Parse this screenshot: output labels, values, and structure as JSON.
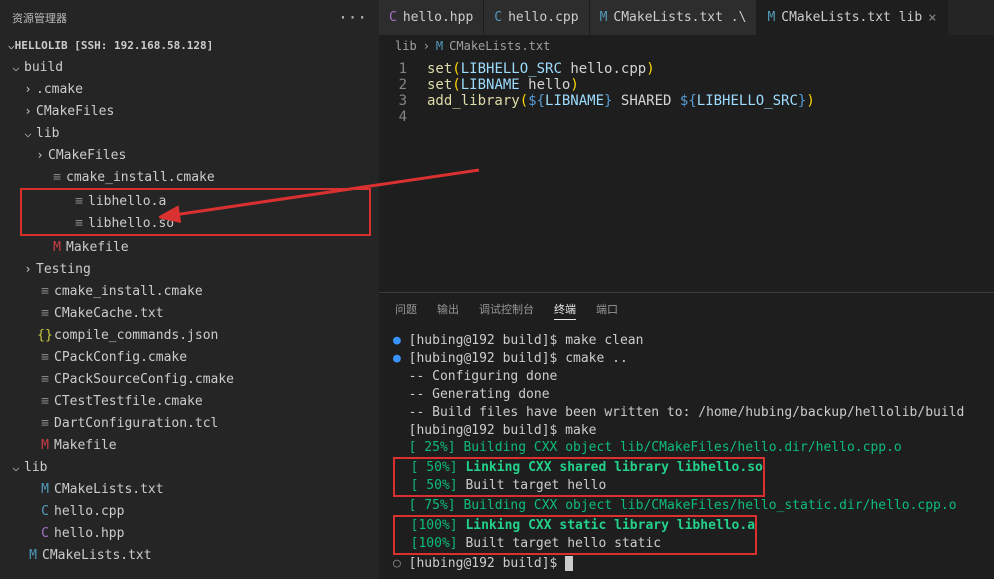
{
  "sidebar": {
    "title": "资源管理器",
    "project": "HELLOLIB [SSH: 192.168.58.128]",
    "tree": [
      {
        "label": "build",
        "type": "folder",
        "open": true,
        "indent": 0
      },
      {
        "label": ".cmake",
        "type": "folder",
        "open": false,
        "indent": 1
      },
      {
        "label": "CMakeFiles",
        "type": "folder",
        "open": false,
        "indent": 1
      },
      {
        "label": "lib",
        "type": "folder",
        "open": true,
        "indent": 1
      },
      {
        "label": "CMakeFiles",
        "type": "folder",
        "open": false,
        "indent": 2
      },
      {
        "label": "cmake_install.cmake",
        "type": "file",
        "icon": "≡",
        "iconClass": "ic-gray",
        "indent": 2
      },
      {
        "label": "libhello.a",
        "type": "file",
        "icon": "≡",
        "iconClass": "ic-gray",
        "indent": 2,
        "boxed": true
      },
      {
        "label": "libhello.so",
        "type": "file",
        "icon": "≡",
        "iconClass": "ic-gray",
        "indent": 2,
        "boxed": true
      },
      {
        "label": "Makefile",
        "type": "file",
        "icon": "M",
        "iconClass": "ic-red",
        "indent": 2
      },
      {
        "label": "Testing",
        "type": "folder",
        "open": false,
        "indent": 1
      },
      {
        "label": "cmake_install.cmake",
        "type": "file",
        "icon": "≡",
        "iconClass": "ic-gray",
        "indent": 1
      },
      {
        "label": "CMakeCache.txt",
        "type": "file",
        "icon": "≡",
        "iconClass": "ic-gray",
        "indent": 1
      },
      {
        "label": "compile_commands.json",
        "type": "file",
        "icon": "{}",
        "iconClass": "ic-yellow",
        "indent": 1
      },
      {
        "label": "CPackConfig.cmake",
        "type": "file",
        "icon": "≡",
        "iconClass": "ic-gray",
        "indent": 1
      },
      {
        "label": "CPackSourceConfig.cmake",
        "type": "file",
        "icon": "≡",
        "iconClass": "ic-gray",
        "indent": 1
      },
      {
        "label": "CTestTestfile.cmake",
        "type": "file",
        "icon": "≡",
        "iconClass": "ic-gray",
        "indent": 1
      },
      {
        "label": "DartConfiguration.tcl",
        "type": "file",
        "icon": "≡",
        "iconClass": "ic-gray",
        "indent": 1
      },
      {
        "label": "Makefile",
        "type": "file",
        "icon": "M",
        "iconClass": "ic-red",
        "indent": 1
      },
      {
        "label": "lib",
        "type": "folder",
        "open": true,
        "indent": 0
      },
      {
        "label": "CMakeLists.txt",
        "type": "file",
        "icon": "M",
        "iconClass": "ic-blue",
        "indent": 1
      },
      {
        "label": "hello.cpp",
        "type": "file",
        "icon": "C",
        "iconClass": "ic-blue",
        "indent": 1
      },
      {
        "label": "hello.hpp",
        "type": "file",
        "icon": "C",
        "iconClass": "ic-purple",
        "indent": 1
      },
      {
        "label": "CMakeLists.txt",
        "type": "file",
        "icon": "M",
        "iconClass": "ic-blue",
        "indent": 0
      }
    ]
  },
  "tabs": [
    {
      "label": "hello.hpp",
      "icon": "C",
      "iconClass": "ic-purple",
      "active": false
    },
    {
      "label": "hello.cpp",
      "icon": "C",
      "iconClass": "ic-blue",
      "active": false
    },
    {
      "label": "CMakeLists.txt .\\",
      "icon": "M",
      "iconClass": "ic-blue",
      "active": false
    },
    {
      "label": "CMakeLists.txt lib",
      "icon": "M",
      "iconClass": "ic-blue",
      "active": true
    }
  ],
  "breadcrumb": {
    "path": "lib",
    "sep": "›",
    "file": "CMakeLists.txt",
    "icon": "M"
  },
  "editor": {
    "lines": [
      {
        "n": 1,
        "segs": [
          [
            "c-fn",
            "set"
          ],
          [
            "c-br",
            "("
          ],
          [
            "c-var",
            "LIBHELLO_SRC"
          ],
          [
            "c-punc",
            " hello.cpp"
          ],
          [
            "c-br",
            ")"
          ]
        ]
      },
      {
        "n": 2,
        "segs": [
          [
            "c-fn",
            "set"
          ],
          [
            "c-br",
            "("
          ],
          [
            "c-var",
            "LIBNAME"
          ],
          [
            "c-punc",
            " hello"
          ],
          [
            "c-br",
            ")"
          ]
        ]
      },
      {
        "n": 3,
        "segs": [
          [
            "c-fn",
            "add_library"
          ],
          [
            "c-br",
            "("
          ],
          [
            "c-kw",
            "${"
          ],
          [
            "c-var",
            "LIBNAME"
          ],
          [
            "c-kw",
            "}"
          ],
          [
            "c-punc",
            " SHARED "
          ],
          [
            "c-kw",
            "${"
          ],
          [
            "c-var",
            "LIBHELLO_SRC"
          ],
          [
            "c-kw",
            "}"
          ],
          [
            "c-br",
            ")"
          ]
        ]
      },
      {
        "n": 4,
        "segs": []
      }
    ]
  },
  "panel": {
    "tabs": [
      "问题",
      "输出",
      "调试控制台",
      "终端",
      "端口"
    ],
    "active": 3,
    "terminal": [
      {
        "bullet": "●",
        "bc": "t-bullet",
        "text": "[hubing@192 build]$ make clean"
      },
      {
        "bullet": "●",
        "bc": "t-bullet",
        "text": "[hubing@192 build]$ cmake .."
      },
      {
        "text": "  -- Configuring done"
      },
      {
        "text": "  -- Generating done"
      },
      {
        "text": "  -- Build files have been written to: /home/hubing/backup/hellolib/build"
      },
      {
        "text": "  [hubing@192 build]$ make"
      },
      {
        "pct": "[ 25%]",
        "pc": "t-green",
        "rest": " Building CXX object lib/CMakeFiles/hello.dir/hello.cpp.o",
        "rc": "t-green"
      },
      {
        "pct": "[ 50%]",
        "pc": "t-green",
        "rest": " Linking CXX shared library libhello.so",
        "rc": "t-greenb",
        "boxed": true
      },
      {
        "pct": "[ 50%]",
        "pc": "t-green",
        "rest": " Built target hello",
        "boxed": true
      },
      {
        "pct": "[ 75%]",
        "pc": "t-green",
        "rest": " Building CXX object lib/CMakeFiles/hello_static.dir/hello.cpp.o",
        "rc": "t-green"
      },
      {
        "pct": "[100%]",
        "pc": "t-green",
        "rest": " Linking CXX static library libhello.a",
        "rc": "t-greenb",
        "boxed2": true
      },
      {
        "pct": "[100%]",
        "pc": "t-green",
        "rest": " Built target hello static",
        "boxed2": true
      },
      {
        "bullet": "○",
        "bc": "t-circle",
        "text": "[hubing@192 build]$ ",
        "cursor": true
      }
    ]
  }
}
